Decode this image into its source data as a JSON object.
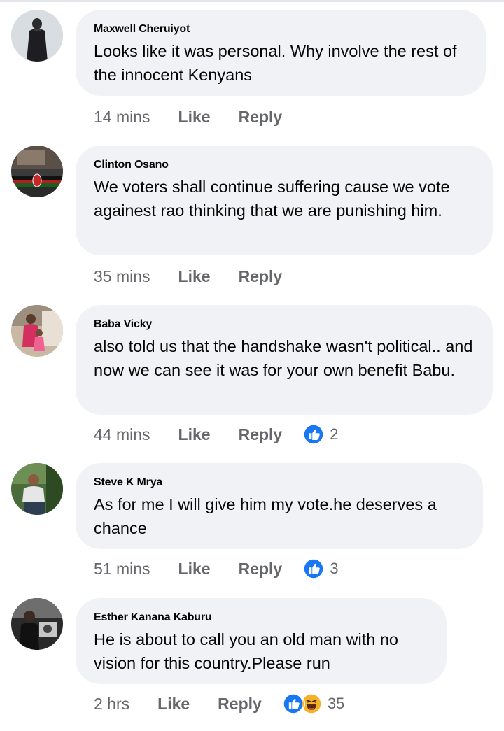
{
  "colors": {
    "bubble": "#f0f2f5",
    "meta_text": "#65676b",
    "like_blue": "#1877f2",
    "haha_yellow": "#f7b125"
  },
  "comments": [
    {
      "author": "Maxwell Cheruiyot",
      "text": "Looks like it was personal. Why involve the rest of the innocent Kenyans",
      "time": "14 mins",
      "like_label": "Like",
      "reply_label": "Reply",
      "avatar_icon": "avatar-photo-icon"
    },
    {
      "author": "Clinton Osano",
      "text": "We voters shall continue suffering cause we vote againest rao thinking that we are punishing him.",
      "time": "35 mins",
      "like_label": "Like",
      "reply_label": "Reply",
      "avatar_icon": "avatar-photo-icon"
    },
    {
      "author": "Baba Vicky",
      "text": "also told us that the handshake wasn't political.. and now we can see it was for your own benefit Babu.",
      "time": "44 mins",
      "like_label": "Like",
      "reply_label": "Reply",
      "reaction_count": "2",
      "reactions": [
        "like-reaction-icon"
      ],
      "avatar_icon": "avatar-photo-icon"
    },
    {
      "author": "Steve K Mrya",
      "text": "As for me I will give him my vote.he deserves a chance",
      "time": "51 mins",
      "like_label": "Like",
      "reply_label": "Reply",
      "reaction_count": "3",
      "reactions": [
        "like-reaction-icon"
      ],
      "avatar_icon": "avatar-photo-icon"
    },
    {
      "author": "Esther Kanana Kaburu",
      "text": "He is about to call you  an old man with no vision for this country.Please run",
      "time": "2 hrs",
      "like_label": "Like",
      "reply_label": "Reply",
      "reaction_count": "35",
      "reactions": [
        "like-reaction-icon",
        "haha-reaction-icon"
      ],
      "avatar_icon": "avatar-photo-icon"
    }
  ]
}
